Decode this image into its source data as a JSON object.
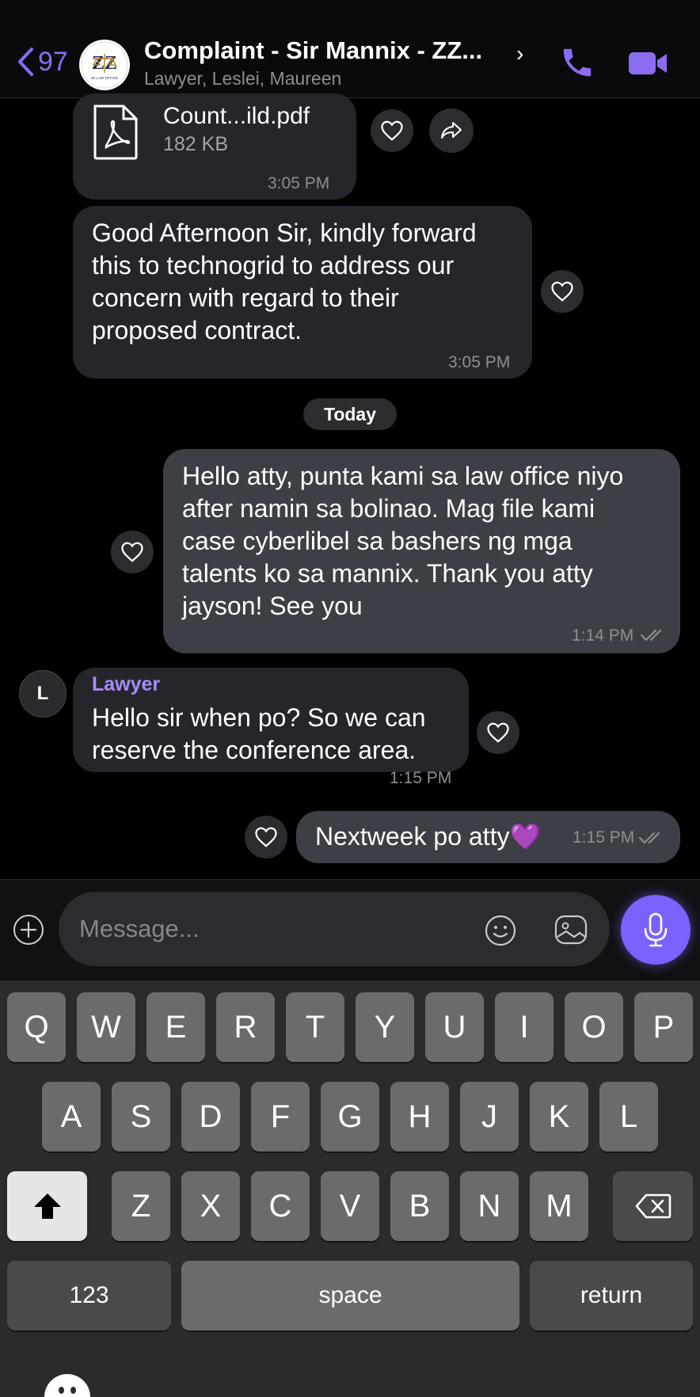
{
  "header": {
    "back_count": "97",
    "title": "Complaint - Sir Mannix - ZZ...",
    "subtitle": "Lawyer, Leslei, Maureen",
    "logo_text": "ZZ LAW OFFICE"
  },
  "messages": [
    {
      "type": "file",
      "direction": "in",
      "file_name": "Count...ild.pdf",
      "file_size": "182 KB",
      "time": "3:05 PM"
    },
    {
      "type": "text",
      "direction": "in",
      "text": "Good Afternoon Sir, kindly forward this to technogrid to address our concern with regard to their proposed contract.",
      "lines": [
        "Good Afternoon Sir, kindly forward",
        "this to technogrid to address our",
        "concern with regard to their",
        "proposed contract."
      ],
      "time": "3:05 PM"
    },
    {
      "type": "date",
      "label": "Today"
    },
    {
      "type": "text",
      "direction": "out",
      "lines": [
        "Hello atty, punta kami sa law office niyo",
        "after namin sa bolinao. Mag file kami",
        "case cyberlibel sa bashers ng mga",
        "talents ko sa mannix. Thank you atty",
        "jayson! See you"
      ],
      "time": "1:14 PM",
      "status": "read"
    },
    {
      "type": "text",
      "direction": "in",
      "sender": "Lawyer",
      "sender_initial": "L",
      "lines": [
        "Hello sir when po? So we can",
        "reserve the conference area."
      ],
      "time": "1:15 PM"
    },
    {
      "type": "text",
      "direction": "out",
      "text": "Nextweek po atty💜",
      "time": "1:15 PM",
      "status": "read"
    }
  ],
  "composer": {
    "placeholder": "Message..."
  },
  "keyboard": {
    "row1": [
      "Q",
      "W",
      "E",
      "R",
      "T",
      "Y",
      "U",
      "I",
      "O",
      "P"
    ],
    "row2": [
      "A",
      "S",
      "D",
      "F",
      "G",
      "H",
      "J",
      "K",
      "L"
    ],
    "row3": [
      "Z",
      "X",
      "C",
      "V",
      "B",
      "N",
      "M"
    ],
    "numbers_label": "123",
    "space_label": "space",
    "return_label": "return"
  },
  "colors": {
    "accent": "#8b6cf0",
    "mic_button": "#7b61ff",
    "incoming_bubble": "#25262b",
    "outgoing_bubble": "#3c4046",
    "sender_name": "#a78bfa"
  }
}
